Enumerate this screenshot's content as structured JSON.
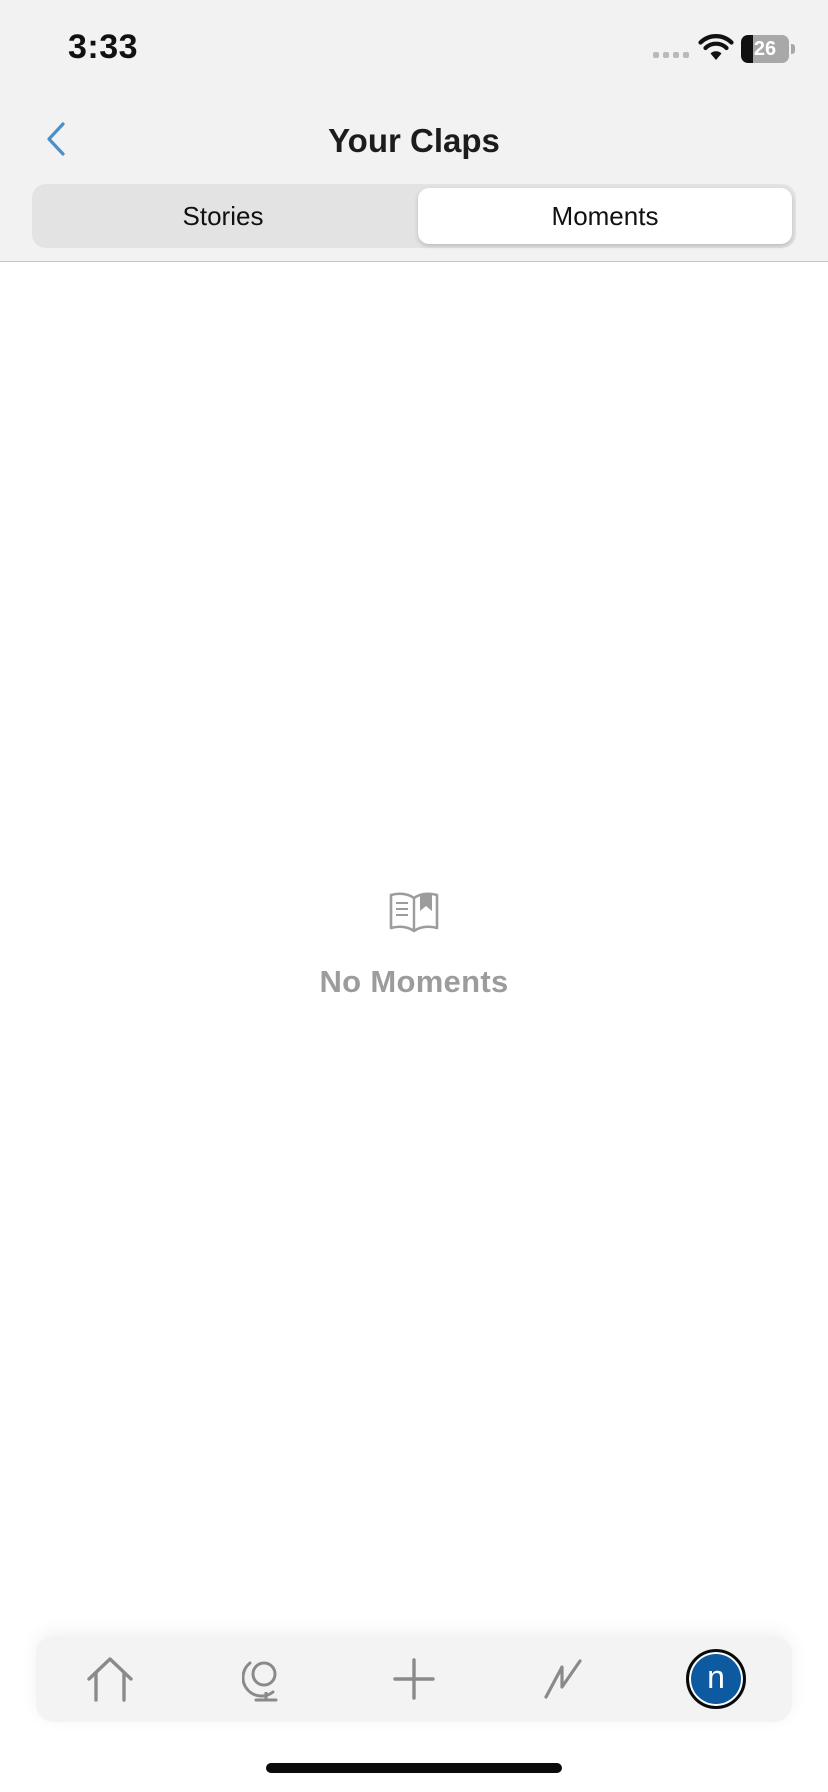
{
  "status_bar": {
    "time": "3:33",
    "battery_level": "26",
    "battery_fraction": 0.26
  },
  "header": {
    "title": "Your Claps",
    "back_icon": "chevron-left-icon",
    "accent_color": "#4a8fc9"
  },
  "segments": {
    "items": [
      {
        "label": "Stories",
        "selected": false
      },
      {
        "label": "Moments",
        "selected": true
      }
    ]
  },
  "empty_state": {
    "icon": "open-book-icon",
    "label": "No Moments"
  },
  "tab_bar": {
    "items": [
      {
        "icon": "home-icon"
      },
      {
        "icon": "globe-icon"
      },
      {
        "icon": "plus-icon"
      },
      {
        "icon": "activity-icon"
      },
      {
        "icon": "avatar",
        "initial": "n",
        "color": "#0d5aa0"
      }
    ]
  }
}
